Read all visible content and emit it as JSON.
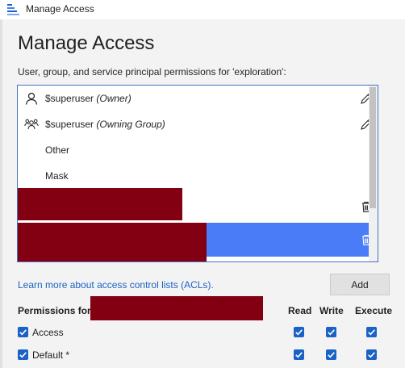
{
  "window": {
    "title": "Manage Access"
  },
  "header": {
    "heading": "Manage Access",
    "subtitle": "User, group, and service principal permissions for 'exploration':"
  },
  "acl_list": {
    "rows": [
      {
        "name": "$superuser",
        "role": "(Owner)",
        "icon": "person-icon",
        "action_icon": "pencil-icon"
      },
      {
        "name": "$superuser",
        "role": "(Owning Group)",
        "icon": "group-icon",
        "action_icon": "pencil-icon"
      },
      {
        "name": "Other",
        "role": "",
        "icon": "",
        "action_icon": ""
      },
      {
        "name": "Mask",
        "role": "",
        "icon": "",
        "action_icon": ""
      },
      {
        "name": "",
        "role": "",
        "icon": "",
        "action_icon": "trash-icon",
        "redacted": true
      },
      {
        "name": "",
        "role": "",
        "icon": "",
        "action_icon": "trash-icon",
        "redacted": true,
        "selected": true
      }
    ]
  },
  "footer": {
    "learn_link": "Learn more about access control lists (ACLs).",
    "add_label": "Add"
  },
  "permissions": {
    "label": "Permissions for:",
    "columns": [
      "Read",
      "Write",
      "Execute"
    ],
    "rows": [
      {
        "label": "Access",
        "enabled": true,
        "read": true,
        "write": true,
        "execute": true
      },
      {
        "label": "Default *",
        "enabled": true,
        "read": true,
        "write": true,
        "execute": true
      }
    ]
  },
  "colors": {
    "accent": "#1a62c6",
    "selection": "#4a7cf7",
    "redaction": "#830012",
    "list_border": "#4472c4"
  }
}
